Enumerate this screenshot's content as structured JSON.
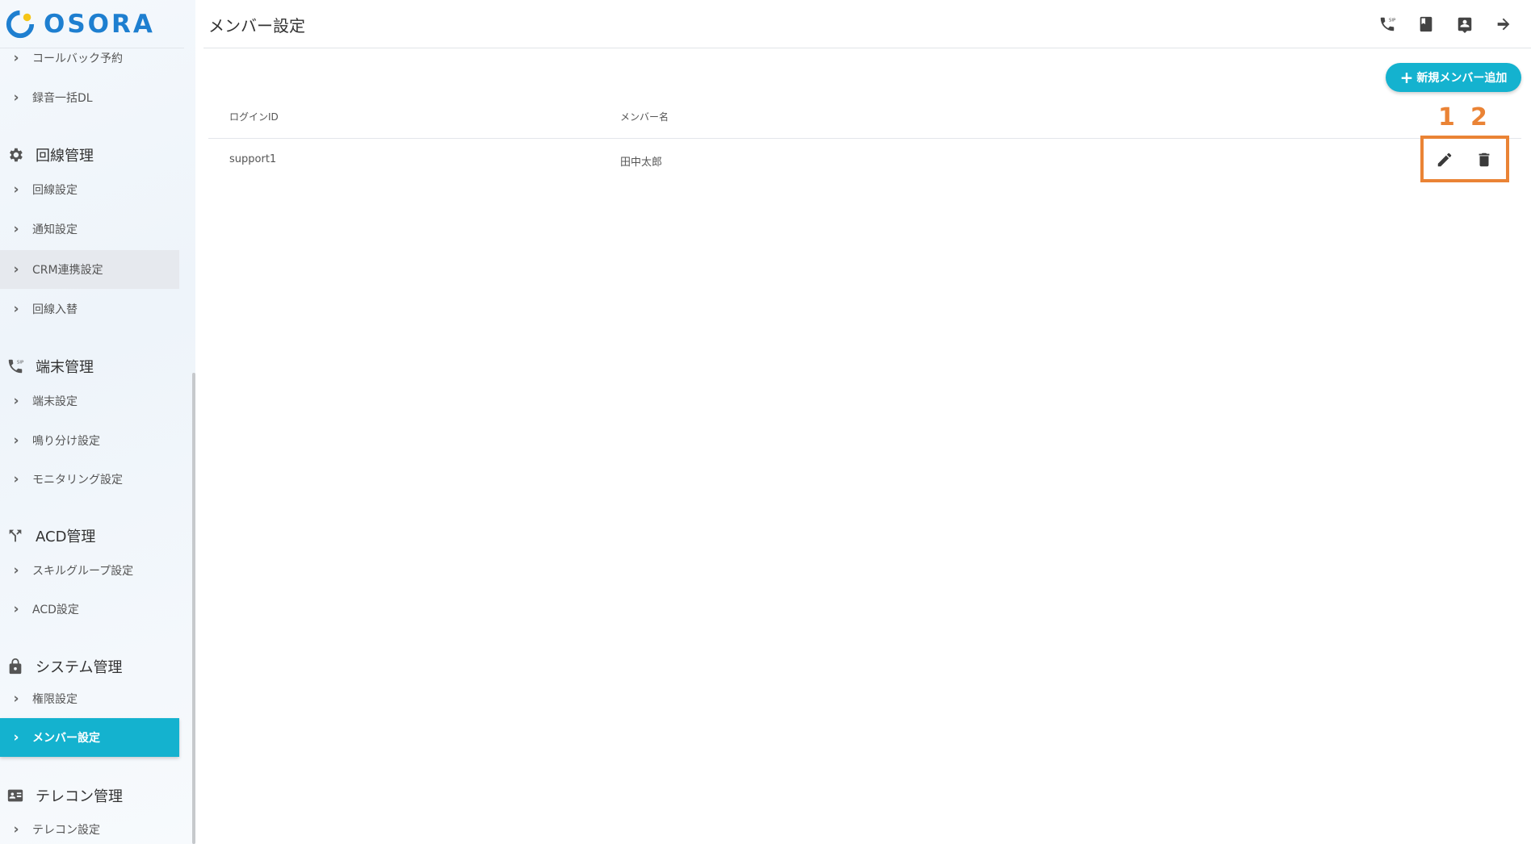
{
  "app": {
    "logo_text": "OSORA",
    "accent_color": "#14b2cf",
    "brand_color": "#1e7fd0",
    "annotation_color": "#ea8335"
  },
  "header": {
    "title": "メンバー設定",
    "actions": [
      {
        "icon": "sip-phone-icon"
      },
      {
        "icon": "book-icon"
      },
      {
        "icon": "contact-icon"
      },
      {
        "icon": "logout-arrow-icon"
      }
    ]
  },
  "sidebar": {
    "items": [
      {
        "label": "コールバック予約"
      },
      {
        "label": "録音一括DL"
      }
    ],
    "sections": [
      {
        "title": "回線管理",
        "icon": "gear-icon",
        "items": [
          {
            "label": "回線設定"
          },
          {
            "label": "通知設定"
          },
          {
            "label": "CRM連携設定",
            "state": "hover"
          },
          {
            "label": "回線入替"
          }
        ]
      },
      {
        "title": "端末管理",
        "icon": "sip-phone-icon",
        "items": [
          {
            "label": "端末設定"
          },
          {
            "label": "鳴り分け設定"
          },
          {
            "label": "モニタリング設定"
          }
        ]
      },
      {
        "title": "ACD管理",
        "icon": "acd-split-icon",
        "items": [
          {
            "label": "スキルグループ設定"
          },
          {
            "label": "ACD設定"
          }
        ]
      },
      {
        "title": "システム管理",
        "icon": "lock-icon",
        "items": [
          {
            "label": "権限設定"
          },
          {
            "label": "メンバー設定",
            "state": "active"
          }
        ]
      },
      {
        "title": "テレコン管理",
        "icon": "id-card-icon",
        "items": [
          {
            "label": "テレコン設定"
          }
        ]
      }
    ]
  },
  "main": {
    "add_button": {
      "plus": "+",
      "label": "新規メンバー追加"
    },
    "table": {
      "columns": [
        "ログインID",
        "メンバー名"
      ],
      "rows": [
        {
          "login_id": "support1",
          "member_name": "田中太郎",
          "actions": [
            "edit-icon",
            "delete-icon"
          ]
        }
      ]
    },
    "annotations": [
      "1",
      "2"
    ]
  }
}
